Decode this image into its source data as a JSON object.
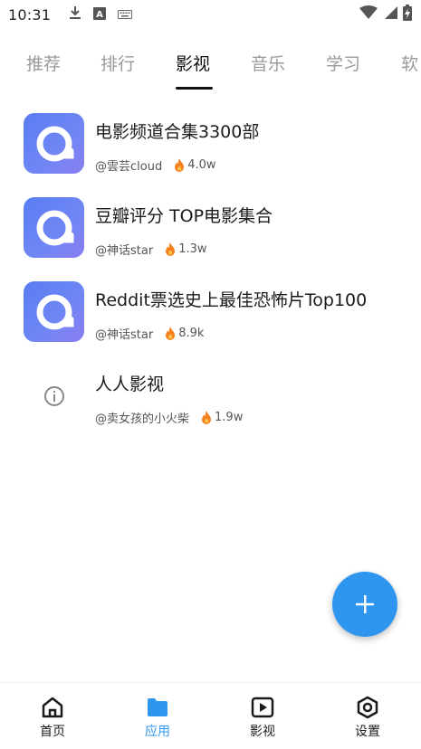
{
  "status_bar": {
    "time": "10:31",
    "left_icons": [
      "download-icon",
      "a-box-icon",
      "keyboard-icon"
    ],
    "right_icons": [
      "wifi-icon",
      "signal-icon",
      "battery-charging-icon"
    ]
  },
  "tabs": [
    {
      "label": "推荐",
      "active": false
    },
    {
      "label": "排行",
      "active": false
    },
    {
      "label": "影视",
      "active": true
    },
    {
      "label": "音乐",
      "active": false
    },
    {
      "label": "学习",
      "active": false
    },
    {
      "label": "软",
      "active": false
    }
  ],
  "list": [
    {
      "title": "电影频道合集3300部",
      "author": "@雲芸cloud",
      "heat": "4.0w",
      "icon": "app-logo-icon"
    },
    {
      "title": "豆瓣评分 TOP电影集合",
      "author": "@神话star",
      "heat": "1.3w",
      "icon": "app-logo-icon"
    },
    {
      "title": "Reddit票选史上最佳恐怖片Top100",
      "author": "@神话star",
      "heat": "8.9k",
      "icon": "app-logo-icon"
    },
    {
      "title": "人人影视",
      "author": "@卖女孩的小火柴",
      "heat": "1.9w",
      "icon": "info-icon"
    }
  ],
  "fab": {
    "icon": "plus-icon"
  },
  "bottom_nav": [
    {
      "label": "首页",
      "icon": "home-icon",
      "active": false
    },
    {
      "label": "应用",
      "icon": "folder-icon",
      "active": true
    },
    {
      "label": "影视",
      "icon": "play-icon",
      "active": false
    },
    {
      "label": "设置",
      "icon": "settings-icon",
      "active": false
    }
  ],
  "colors": {
    "accent": "#2f96ef",
    "logo_gradient_start": "#5a7cf2",
    "logo_gradient_end": "#8a7ff0",
    "fire": "#f5821f"
  }
}
